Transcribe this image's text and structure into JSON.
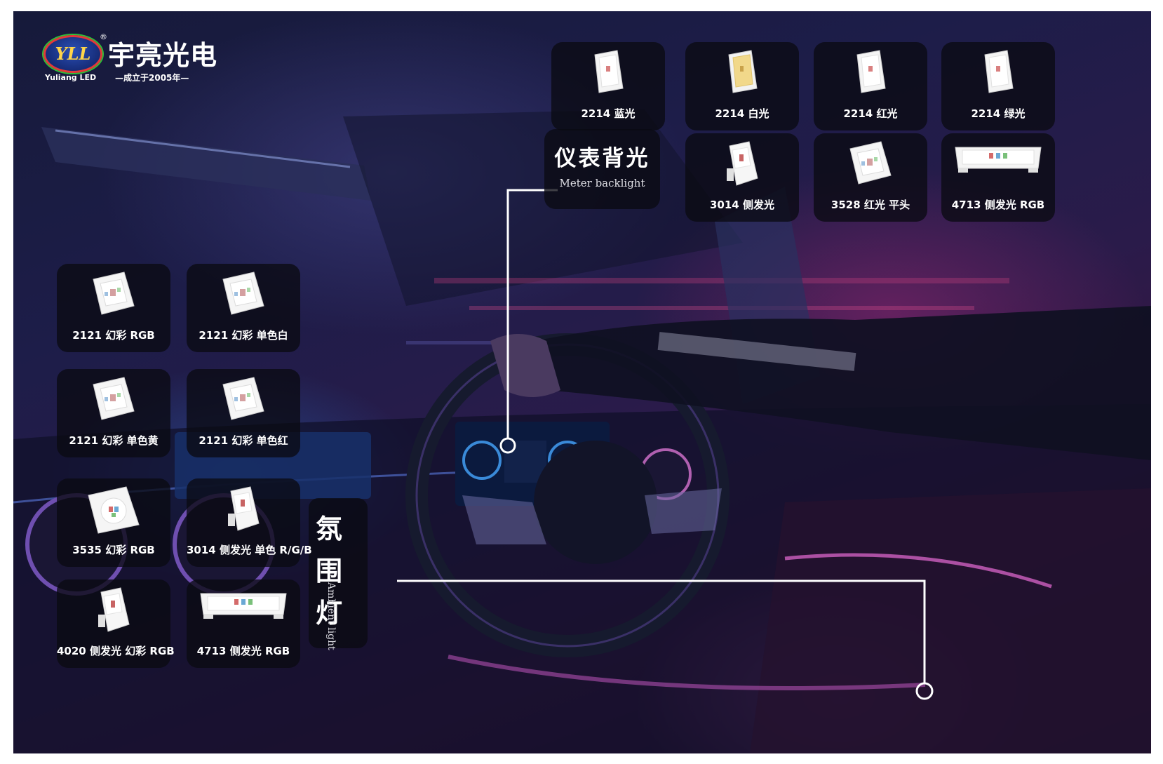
{
  "brand": {
    "logo_text": "YLL",
    "registered_mark": "®",
    "name_cn": "宇亮光电",
    "name_en": "Yuliang LED",
    "tagline": "—成立于2005年—"
  },
  "meter_backlight": {
    "title_cn": "仪表背光",
    "title_en": "Meter backlight",
    "products": [
      {
        "label": "2214 蓝光",
        "chip": "white-top"
      },
      {
        "label": "2214 白光",
        "chip": "yellow-top"
      },
      {
        "label": "2214 红光",
        "chip": "white-top"
      },
      {
        "label": "2214 绿光",
        "chip": "white-top"
      },
      {
        "label": "3014 侧发光",
        "chip": "side"
      },
      {
        "label": "3528 红光 平头",
        "chip": "square"
      },
      {
        "label": "4713 侧发光 RGB",
        "chip": "wide"
      }
    ]
  },
  "ambient_light": {
    "title_cn": "氛围灯",
    "title_en": "Ambient light",
    "products": [
      {
        "label": "2121 幻彩 RGB",
        "chip": "square"
      },
      {
        "label": "2121 幻彩 单色白",
        "chip": "square"
      },
      {
        "label": "2121 幻彩 单色黄",
        "chip": "square"
      },
      {
        "label": "2121 幻彩 单色红",
        "chip": "square"
      },
      {
        "label": "3535 幻彩 RGB",
        "chip": "square-big"
      },
      {
        "label": "3014 侧发光 单色 R/G/B",
        "chip": "side"
      },
      {
        "label": "4020 侧发光 幻彩 RGB",
        "chip": "side"
      },
      {
        "label": "4713 侧发光 RGB",
        "chip": "wide"
      }
    ]
  }
}
